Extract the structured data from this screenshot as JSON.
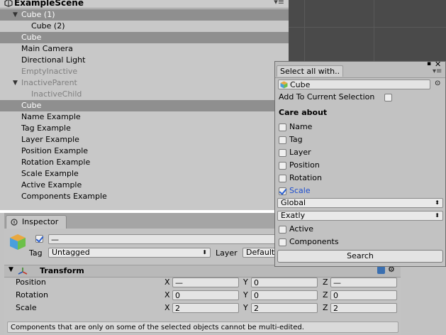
{
  "hierarchy": {
    "scene_name": "ExampleScene",
    "menu_glyph": "▾≡",
    "items": [
      {
        "label": "Cube (1)",
        "indent": 1,
        "arrow": "▼",
        "selected": true,
        "inactive": false
      },
      {
        "label": "Cube (2)",
        "indent": 2,
        "arrow": "",
        "selected": false,
        "inactive": false
      },
      {
        "label": "Cube",
        "indent": 1,
        "arrow": "",
        "selected": true,
        "inactive": false
      },
      {
        "label": "Main Camera",
        "indent": 1,
        "arrow": "",
        "selected": false,
        "inactive": false
      },
      {
        "label": "Directional Light",
        "indent": 1,
        "arrow": "",
        "selected": false,
        "inactive": false
      },
      {
        "label": "EmptyInactive",
        "indent": 1,
        "arrow": "",
        "selected": false,
        "inactive": true
      },
      {
        "label": "InactiveParent",
        "indent": 1,
        "arrow": "▼",
        "selected": false,
        "inactive": true
      },
      {
        "label": "InactiveChild",
        "indent": 2,
        "arrow": "",
        "selected": false,
        "inactive": true
      },
      {
        "label": "Cube",
        "indent": 1,
        "arrow": "",
        "selected": true,
        "inactive": false
      },
      {
        "label": "Name Example",
        "indent": 1,
        "arrow": "",
        "selected": false,
        "inactive": false
      },
      {
        "label": "Tag Example",
        "indent": 1,
        "arrow": "",
        "selected": false,
        "inactive": false
      },
      {
        "label": "Layer Example",
        "indent": 1,
        "arrow": "",
        "selected": false,
        "inactive": false
      },
      {
        "label": "Position Example",
        "indent": 1,
        "arrow": "",
        "selected": false,
        "inactive": false
      },
      {
        "label": "Rotation Example",
        "indent": 1,
        "arrow": "",
        "selected": false,
        "inactive": false
      },
      {
        "label": "Scale Example",
        "indent": 1,
        "arrow": "",
        "selected": false,
        "inactive": false
      },
      {
        "label": "Active Example",
        "indent": 1,
        "arrow": "",
        "selected": false,
        "inactive": false
      },
      {
        "label": "Components Example",
        "indent": 1,
        "arrow": "",
        "selected": false,
        "inactive": false
      }
    ]
  },
  "inspector": {
    "tab_label": "Inspector",
    "name_value": "—",
    "tag_label": "Tag",
    "tag_value": "Untagged",
    "layer_label": "Layer",
    "layer_value": "Default",
    "transform_title": "Transform",
    "rows": [
      {
        "label": "Position",
        "x": "—",
        "y": "0",
        "z": "—"
      },
      {
        "label": "Rotation",
        "x": "0",
        "y": "0",
        "z": "0"
      },
      {
        "label": "Scale",
        "x": "2",
        "y": "2",
        "z": "2"
      }
    ],
    "axis": {
      "x": "X",
      "y": "Y",
      "z": "Z"
    },
    "note": "Components that are only on some of the selected objects cannot be multi-edited."
  },
  "popup": {
    "tab_label": "Select all with..",
    "object_field": "Cube",
    "add_to_selection_label": "Add To Current Selection",
    "add_to_selection_checked": false,
    "care_about_label": "Care about",
    "options": [
      {
        "label": "Name",
        "checked": false
      },
      {
        "label": "Tag",
        "checked": false
      },
      {
        "label": "Layer",
        "checked": false
      },
      {
        "label": "Position",
        "checked": false
      },
      {
        "label": "Rotation",
        "checked": false
      },
      {
        "label": "Scale",
        "checked": true
      }
    ],
    "space_dropdown": "Global",
    "match_dropdown": "Exatly",
    "extra_options": [
      {
        "label": "Active",
        "checked": false
      },
      {
        "label": "Components",
        "checked": false
      }
    ],
    "search_button": "Search",
    "accent_color": "#1f4fcf"
  }
}
